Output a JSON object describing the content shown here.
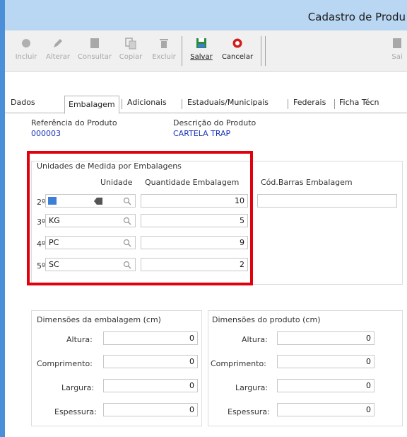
{
  "window": {
    "title": "Cadastro de Produ"
  },
  "toolbar": {
    "incluir": "Incluir",
    "alterar": "Alterar",
    "consultar": "Consultar",
    "copiar": "Copiar",
    "excluir": "Excluir",
    "salvar": "Salvar",
    "cancelar": "Cancelar",
    "sair": "Sai"
  },
  "tabs": {
    "dados": "Dados",
    "embalagem": "Embalagem",
    "adicionais": "Adicionais",
    "estaduais": "Estaduais/Municipais",
    "federais": "Federais",
    "ficha": "Ficha Técn"
  },
  "produto": {
    "ref_label": "Referência do Produto",
    "ref_value": "000003",
    "desc_label": "Descrição do Produto",
    "desc_value": "CARTELA TRAP"
  },
  "unidades": {
    "group_title": "Unidades de Medida por Embalagens",
    "col_unidade": "Unidade",
    "col_quantidade": "Quantidade Embalagem",
    "col_codbarras": "Cód.Barras Embalagem",
    "rows": [
      {
        "ordem": "2º",
        "unidade": "",
        "quantidade": "10"
      },
      {
        "ordem": "3º",
        "unidade": "KG",
        "quantidade": "5"
      },
      {
        "ordem": "4º",
        "unidade": "PC",
        "quantidade": "9"
      },
      {
        "ordem": "5º",
        "unidade": "SC",
        "quantidade": "2"
      }
    ]
  },
  "dim_embalagem": {
    "title": "Dimensões da embalagem (cm)",
    "altura_label": "Altura:",
    "altura": "0",
    "comprimento_label": "Comprimento:",
    "comprimento": "0",
    "largura_label": "Largura:",
    "largura": "0",
    "espessura_label": "Espessura:",
    "espessura": "0"
  },
  "dim_produto": {
    "title": "Dimensões do produto (cm)",
    "altura_label": "Altura:",
    "altura": "0",
    "comprimento_label": "Comprimento:",
    "comprimento": "0",
    "largura_label": "Largura:",
    "largura": "0",
    "espessura_label": "Espessura:",
    "espessura": "0"
  },
  "icons": {
    "incluir": "plus-circle-icon",
    "alterar": "pencil-icon",
    "consultar": "document-icon",
    "copiar": "copy-icon",
    "excluir": "trash-icon",
    "salvar": "floppy-disk-icon",
    "cancelar": "cancel-circle-icon",
    "lookup": "magnifier-icon",
    "erase": "backspace-icon"
  },
  "colors": {
    "highlight": "#e1000b",
    "link_blue": "#1a33b8",
    "titlebar": "#b9d6f3",
    "frame": "#4a8fd8"
  }
}
